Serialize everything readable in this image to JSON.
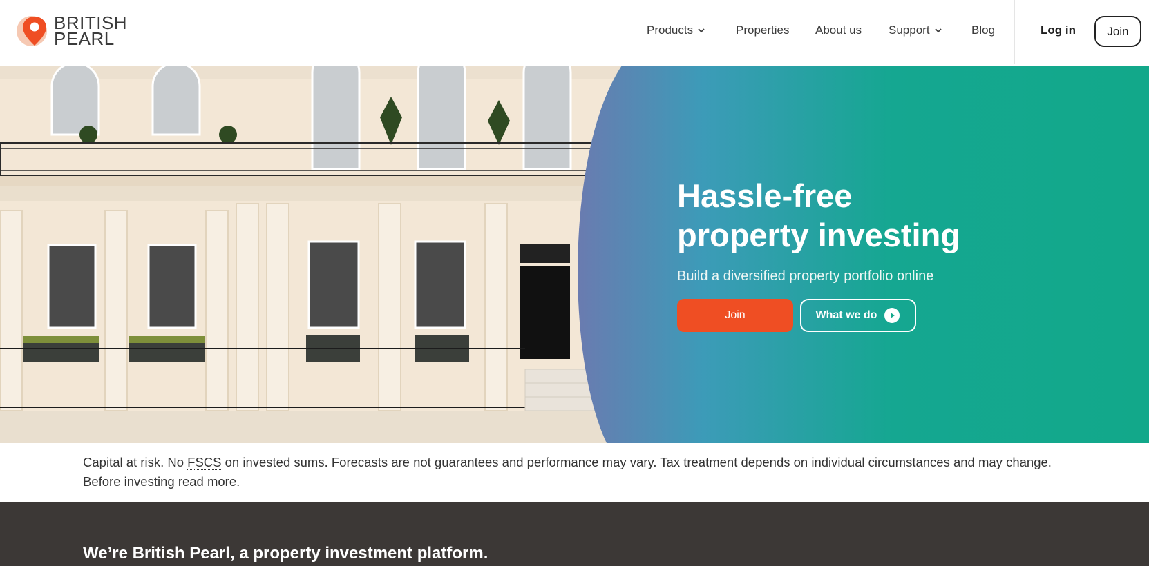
{
  "brand": {
    "name_line1": "BRITISH",
    "name_line2": "PEARL",
    "accent": "#ef4e23",
    "teal": "#13a88a"
  },
  "nav": {
    "products": "Products",
    "properties": "Properties",
    "about": "About us",
    "support": "Support",
    "blog": "Blog",
    "login": "Log in",
    "join": "Join"
  },
  "hero": {
    "headline_line1": "Hassle-free",
    "headline_line2": "property investing",
    "subtitle": "Build a diversified property portfolio online",
    "join_label": "Join",
    "what_label": "What we do"
  },
  "risk": {
    "part1": "Capital at risk. No ",
    "fscs": "FSCS",
    "part2": " on invested sums. Forecasts are not guarantees and performance may vary. Tax treatment depends on individual circumstances and may change. Before investing ",
    "link": "read more",
    "part3": "."
  },
  "about": {
    "title": "We’re British Pearl, a property investment platform."
  }
}
